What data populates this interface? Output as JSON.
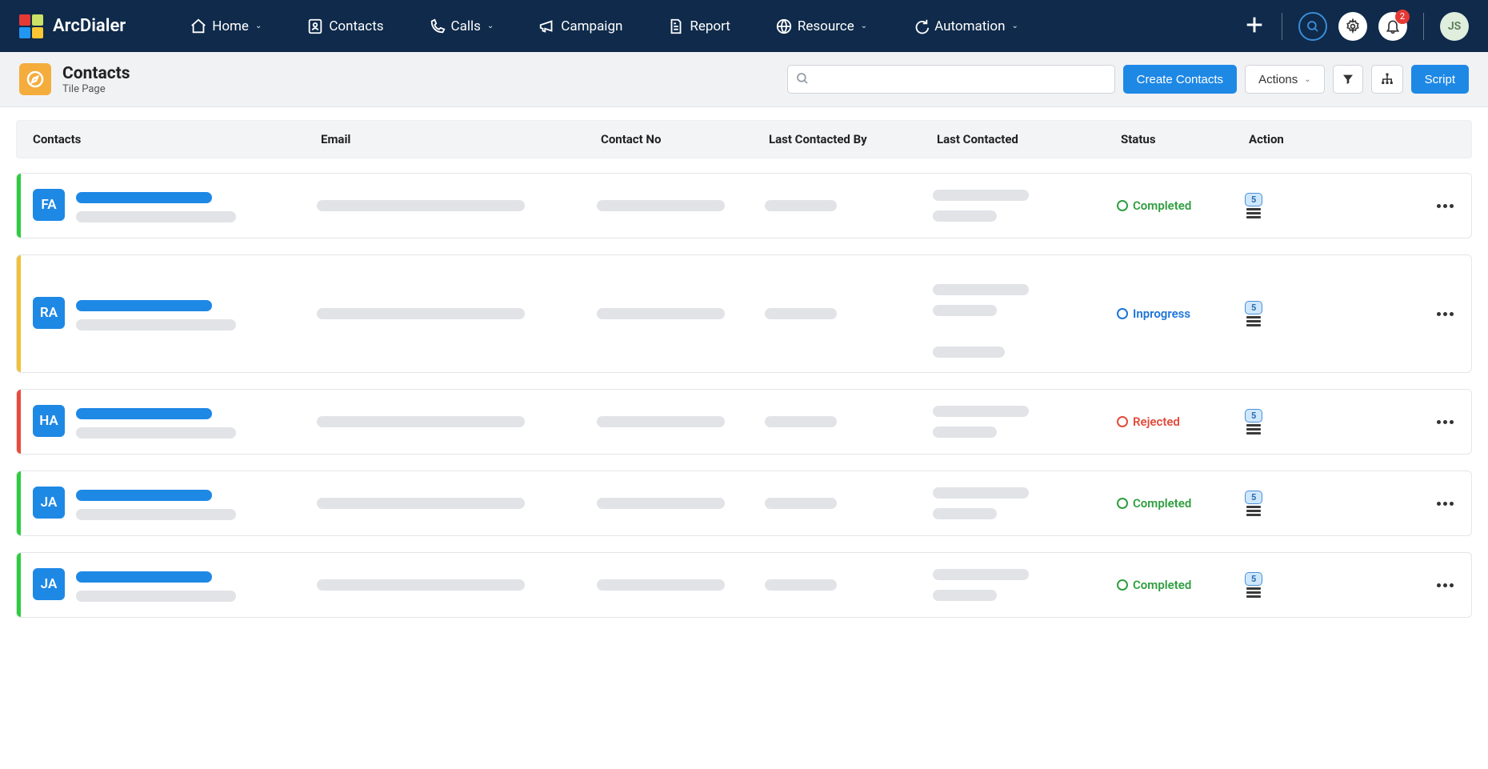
{
  "brand": "ArcDialer",
  "logo_colors": [
    "#e53935",
    "#c9e265",
    "#2196f3",
    "#f9c733"
  ],
  "nav": {
    "home": "Home",
    "contacts": "Contacts",
    "calls": "Calls",
    "campaign": "Campaign",
    "report": "Report",
    "resource": "Resource",
    "automation": "Automation"
  },
  "notif_count": "2",
  "user_initials": "JS",
  "page": {
    "title": "Contacts",
    "subtitle": "Tile Page"
  },
  "search_placeholder": "",
  "buttons": {
    "create": "Create Contacts",
    "actions": "Actions",
    "script": "Script"
  },
  "columns": {
    "contacts": "Contacts",
    "email": "Email",
    "contact_no": "Contact No",
    "last_contacted_by": "Last Contacted By",
    "last_contacted": "Last Contacted",
    "status": "Status",
    "action": "Action"
  },
  "status_labels": {
    "completed": "Completed",
    "inprogress": "Inprogress",
    "rejected": "Rejected"
  },
  "action_badge": "5",
  "rows": [
    {
      "initials": "FA",
      "stripe": "#2ecc40",
      "status": "completed",
      "last_contacted_lines": 2,
      "tall": false
    },
    {
      "initials": "RA",
      "stripe": "#f2c037",
      "status": "inprogress",
      "last_contacted_lines": 2,
      "tall": true
    },
    {
      "initials": "HA",
      "stripe": "#e74c3c",
      "status": "rejected",
      "last_contacted_lines": 2,
      "tall": false
    },
    {
      "initials": "JA",
      "stripe": "#2ecc40",
      "status": "completed",
      "last_contacted_lines": 2,
      "tall": false
    },
    {
      "initials": "JA",
      "stripe": "#2ecc40",
      "status": "completed",
      "last_contacted_lines": 2,
      "tall": false
    }
  ]
}
